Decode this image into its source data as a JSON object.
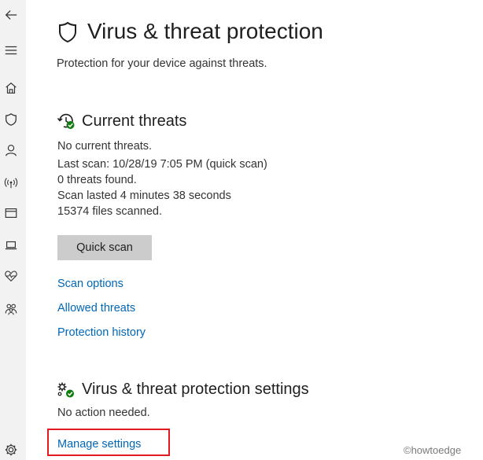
{
  "sidebar": {
    "items": [
      {
        "icon": "back-arrow-icon"
      },
      {
        "icon": "hamburger-menu-icon"
      },
      {
        "icon": "home-icon"
      },
      {
        "icon": "shield-icon"
      },
      {
        "icon": "person-icon"
      },
      {
        "icon": "wireless-icon"
      },
      {
        "icon": "app-browser-icon"
      },
      {
        "icon": "laptop-icon"
      },
      {
        "icon": "heart-pulse-icon"
      },
      {
        "icon": "family-icon"
      },
      {
        "icon": "gear-icon"
      }
    ]
  },
  "header": {
    "title": "Virus & threat protection",
    "subtitle": "Protection for your device against threats."
  },
  "current_threats": {
    "title": "Current threats",
    "status": "No current threats.",
    "last_scan": "Last scan: 10/28/19 7:05 PM (quick scan)",
    "threats_found": "0 threats found.",
    "scan_duration": "Scan lasted 4 minutes 38 seconds",
    "files_scanned": "15374 files scanned.",
    "quick_scan_label": "Quick scan",
    "links": {
      "scan_options": "Scan options",
      "allowed_threats": "Allowed threats",
      "protection_history": "Protection history"
    }
  },
  "settings_section": {
    "title": "Virus & threat protection settings",
    "status": "No action needed.",
    "manage_link": "Manage settings"
  },
  "watermark": "©howtoedge",
  "colors": {
    "link": "#0067b8",
    "status_ok": "#107c10",
    "highlight": "#e2191f",
    "button_bg": "#cccccc"
  }
}
